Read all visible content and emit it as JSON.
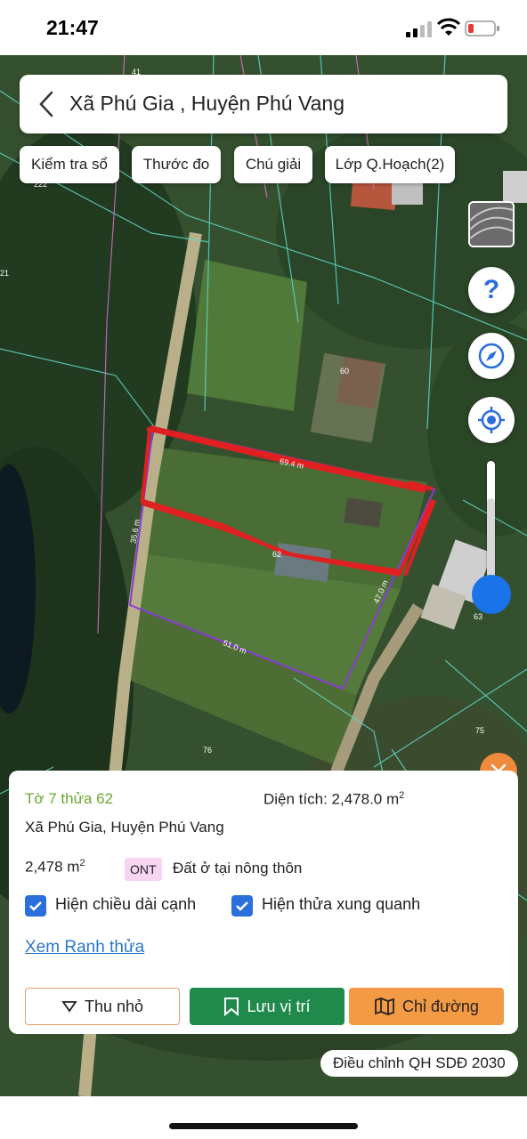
{
  "status_bar": {
    "time": "21:47"
  },
  "header": {
    "title": "Xã Phú Gia , Huyện Phú Vang"
  },
  "chips": [
    {
      "label": "Kiểm tra sổ"
    },
    {
      "label": "Thước đo"
    },
    {
      "label": "Chú giải"
    },
    {
      "label": "Lớp Q.Hoạch(2)"
    }
  ],
  "controls": {
    "help": "?"
  },
  "map_labels": {
    "parcel_41": "41",
    "parcel_222": "222",
    "parcel_21": "21",
    "parcel_60": "60",
    "parcel_62": "62",
    "parcel_63": "63",
    "parcel_75": "75",
    "parcel_76": "76",
    "edge_top": "69.4 m",
    "edge_left": "35.6 m",
    "edge_bottom": "51.0 m",
    "edge_right": "47.0 m"
  },
  "info_card": {
    "sheet_parcel": "Tờ 7 thửa 62",
    "area_label": "Diện tích: 2,478.0 m",
    "area_sup": "2",
    "address": "Xã Phú Gia, Huyện Phú Vang",
    "area_short": "2,478 m",
    "area_short_sup": "2",
    "land_code": "ONT",
    "land_type": "Đất ở tại nông thôn",
    "checkbox_edges": "Hiện chiều dài cạnh",
    "checkbox_neighbors": "Hiện thửa xung quanh",
    "link_boundary": "Xem Ranh thửa",
    "btn_collapse": "Thu nhỏ",
    "btn_save": "Lưu vị trí",
    "btn_route": "Chỉ đường"
  },
  "plan_pill": "Điều chỉnh QH SDĐ 2030",
  "colors": {
    "accent_green": "#1f8a4c",
    "accent_orange": "#f39a45",
    "parcel_outline": "#8a3ad9",
    "annotation_red": "#e02020"
  }
}
